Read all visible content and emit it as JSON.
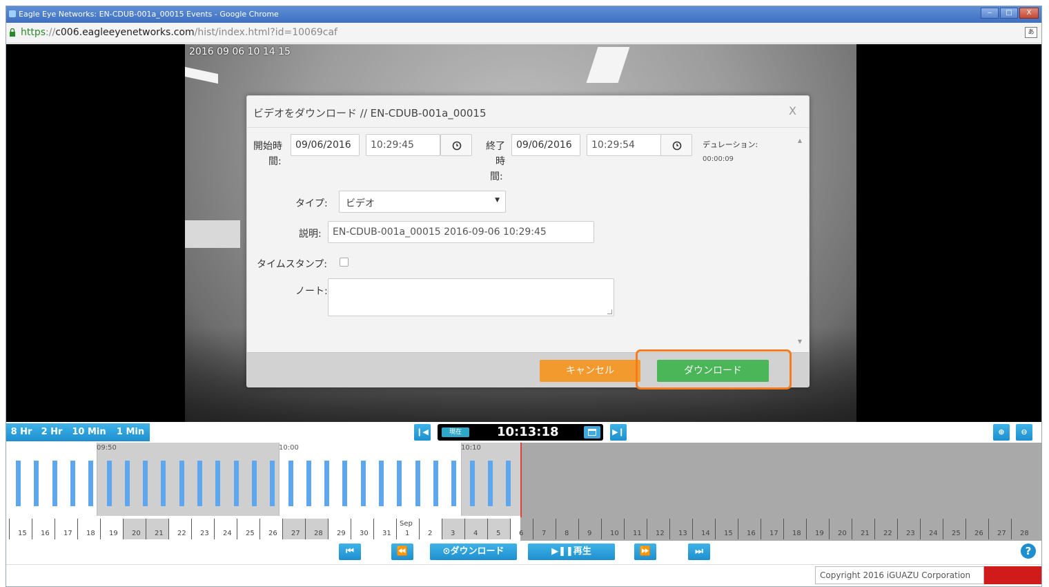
{
  "window": {
    "title": "Eagle Eye Networks: EN-CDUB-001a_00015 Events - Google Chrome",
    "controls": [
      "‒",
      "□",
      "X"
    ]
  },
  "address_bar": {
    "protocol": "https",
    "separator": "://",
    "host": "c006.eagleeyenetworks.com",
    "path": "/hist/index.html?id=10069caf"
  },
  "video": {
    "timestamp": "2016 09 06 10 14 15"
  },
  "modal": {
    "title": "ビデオをダウンロード // EN-CDUB-001a_00015",
    "close": "X",
    "start_label_1": "開始時",
    "start_label_2": "間:",
    "start_date": "09/06/2016",
    "start_time": "10:29:45",
    "end_label_1": "終了",
    "end_label_2": "時",
    "end_label_3": "間:",
    "end_date": "09/06/2016",
    "end_time": "10:29:54",
    "duration_label": "デュレーション:",
    "duration_value": "00:00:09",
    "type_label": "タイプ:",
    "type_value": "ビデオ",
    "description_label": "説明:",
    "description_value": "EN-CDUB-001a_00015 2016-09-06 10:29:45",
    "timestamp_label": "タイムスタンプ:",
    "timestamp_checked": false,
    "note_label": "ノート:",
    "note_value": "",
    "cancel_label": "キャンセル",
    "download_label": "ダウンロード",
    "cancel_color": "#f7941d",
    "download_color": "#3cb44b",
    "highlight_color": "#f47b20"
  },
  "timeline": {
    "ranges": [
      "8 Hr",
      "2 Hr",
      "10 Min",
      "1 Min"
    ],
    "now_badge": "現在",
    "current_time": "10:13:18",
    "time_labels": [
      "09:50",
      "10:00",
      "10:10"
    ],
    "days_before": [
      "15",
      "16",
      "17",
      "18",
      "19",
      "20",
      "21",
      "22",
      "23",
      "24",
      "25",
      "26",
      "27",
      "28",
      "29",
      "30",
      "31"
    ],
    "month_label": "Sep",
    "days_after": [
      "1",
      "2",
      "3",
      "4",
      "5",
      "6",
      "7",
      "8",
      "9",
      "10",
      "11",
      "12",
      "13",
      "14",
      "15",
      "16",
      "17",
      "18",
      "19",
      "20",
      "21",
      "22",
      "23",
      "24",
      "25",
      "26",
      "27",
      "28"
    ]
  },
  "playback": {
    "download_label": "⊙ダウンロード",
    "play_label": "▶❚❚再生"
  },
  "footer": {
    "copyright": "Copyright 2016 iGUAZU Corporation"
  }
}
